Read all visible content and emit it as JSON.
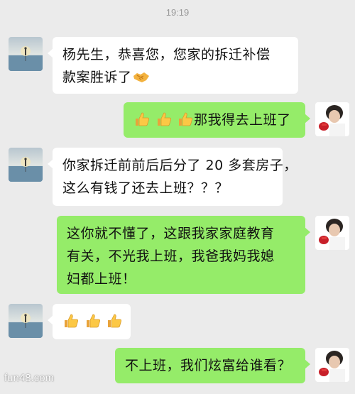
{
  "status": {
    "time": "19:19"
  },
  "contacts": {
    "left_avatar_icon": "landscape-figure-avatar",
    "right_avatar_icon": "person-with-red-item-avatar"
  },
  "messages": [
    {
      "side": "left",
      "text_line1": "杨先生，恭喜您，您家的拆迁补偿",
      "text_line2": "款案胜诉了",
      "emoji": "handshake"
    },
    {
      "side": "right",
      "emoji": "thumbs-up x3",
      "text": "那我得去上班了"
    },
    {
      "side": "left",
      "text_line1": "你家拆迁前前后后分了 20 多套房子，",
      "text_line2": "这么有钱了还去上班？？？"
    },
    {
      "side": "right",
      "text_line1": "这你就不懂了，这跟我家家庭教育",
      "text_line2": "有关，不光我上班，我爸我妈我媳",
      "text_line3": "妇都上班！"
    },
    {
      "side": "left",
      "emoji": "thumbs-up x3"
    },
    {
      "side": "right",
      "text": "不上班，我们炫富给谁看？"
    }
  ],
  "watermark": "fun48.com",
  "colors": {
    "background": "#ebebeb",
    "left_bubble": "#ffffff",
    "right_bubble": "#95ec69"
  }
}
